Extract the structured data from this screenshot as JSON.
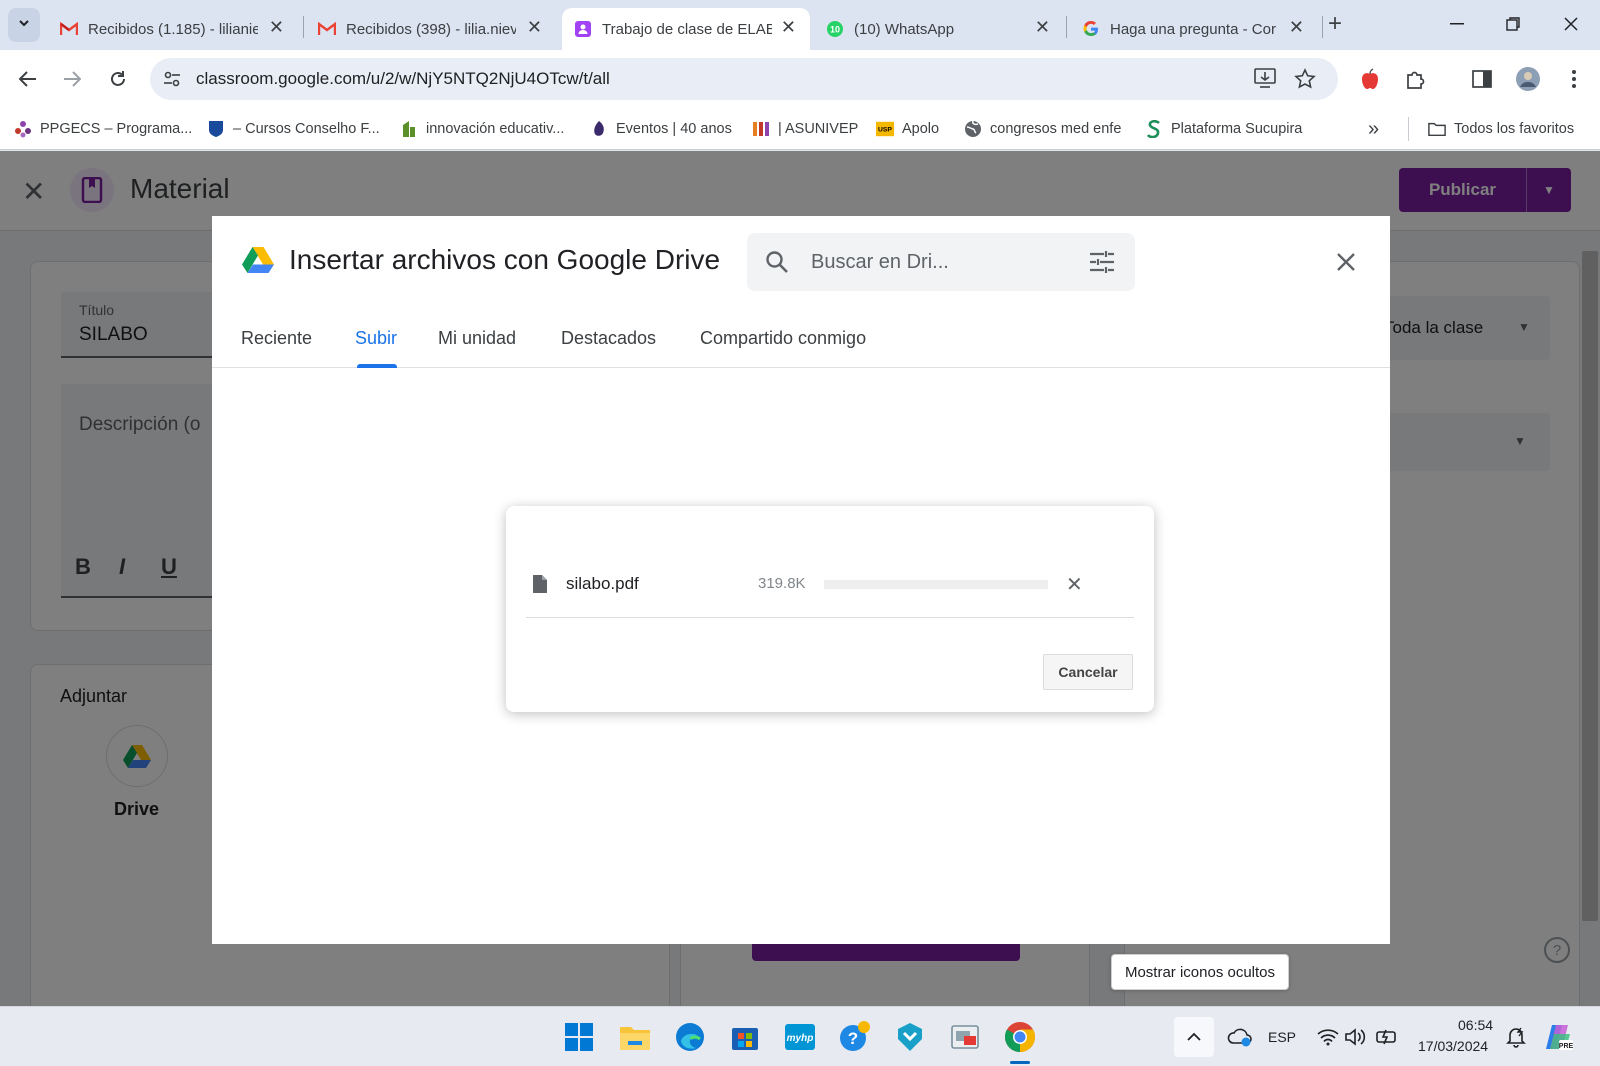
{
  "browser": {
    "tabs": [
      {
        "title": "Recibidos (1.185) - lilianie",
        "icon": "gmail-icon"
      },
      {
        "title": "Recibidos (398) - lilia.niev",
        "icon": "gmail-icon"
      },
      {
        "title": "Trabajo de clase de ELAB",
        "icon": "classroom-icon",
        "active": true
      },
      {
        "title": "(10) WhatsApp",
        "icon": "whatsapp-icon",
        "badge": "10"
      },
      {
        "title": "Haga una pregunta - Cor",
        "icon": "google-icon"
      }
    ],
    "url": "classroom.google.com/u/2/w/NjY5NTQ2NjU4OTcw/t/all",
    "bookmarks": [
      "PPGECS – Programa...",
      "– Cursos Conselho F...",
      "innovación educativ...",
      "Eventos | 40 anos",
      "| ASUNIVEP",
      "Apolo",
      "congresos med enfe",
      "Plataforma Sucupira"
    ],
    "bookmark_icons": [
      "ppgecs-icon",
      "shield-icon",
      "building-icon",
      "eventos-icon",
      "asunivep-icon",
      "usp-icon",
      "globe-icon",
      "sucupira-icon"
    ],
    "favorites_label": "Todos los favoritos",
    "more_bookmarks": "»"
  },
  "classroom": {
    "page_title": "Material",
    "publish_label": "Publicar",
    "title_label": "Título",
    "title_value": "SILABO",
    "description_placeholder": "Descripción (o",
    "attach_label": "Adjuntar",
    "drive_label": "Drive",
    "audience_value": "Toda la clase",
    "format_bold": "B",
    "format_italic": "I",
    "format_underline": "U"
  },
  "picker": {
    "title": "Insertar archivos con Google Drive",
    "search_placeholder": "Buscar en Dri...",
    "tabs": [
      "Reciente",
      "Subir",
      "Mi unidad",
      "Destacados",
      "Compartido conmigo"
    ],
    "active_tab": "Subir",
    "upload": {
      "file_name": "silabo.pdf",
      "file_size": "319.8K",
      "progress": 0,
      "cancel_label": "Cancelar"
    }
  },
  "tooltip": "Mostrar iconos ocultos",
  "taskbar": {
    "language": "ESP",
    "time": "06:54",
    "date": "17/03/2024"
  },
  "colors": {
    "accent_purple": "#7b1fa2",
    "picker_blue": "#1a73e8"
  }
}
